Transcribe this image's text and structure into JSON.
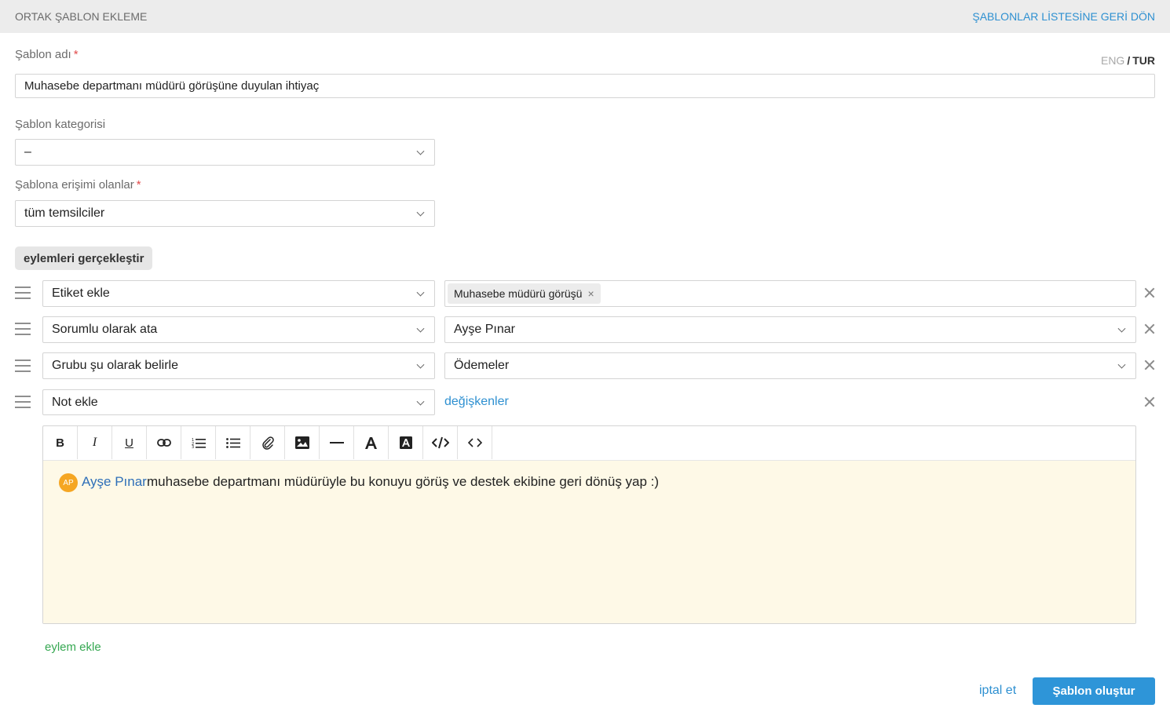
{
  "header": {
    "title": "ORTAK ŞABLON EKLEME",
    "back_link": "ŞABLONLAR LİSTESİNE GERİ DÖN"
  },
  "lang": {
    "eng": "ENG",
    "separator": "/",
    "tur": "TUR",
    "active": "TUR"
  },
  "form": {
    "name_label": "Şablon adı",
    "required_mark": "*",
    "name_value": "Muhasebe departmanı müdürü görüşüne duyulan ihtiyaç",
    "category_label": "Şablon kategorisi",
    "category_value": "–",
    "access_label": "Şablona erişimi olanlar",
    "access_value": "tüm temsilciler"
  },
  "actions": {
    "title": "eylemleri gerçekleştir",
    "rows": [
      {
        "action": "Etiket ekle",
        "tag": "Muhasebe müdürü görüşü",
        "tag_remove": "×"
      },
      {
        "action": "Sorumlu olarak ata",
        "value": "Ayşe Pınar"
      },
      {
        "action": "Grubu şu olarak belirle",
        "value": "Ödemeler"
      },
      {
        "action": "Not ekle",
        "variables_link": "değişkenler"
      }
    ],
    "add_action": "eylem ekle"
  },
  "editor": {
    "toolbar": [
      "bold",
      "italic",
      "underline",
      "link",
      "ordered-list",
      "bullet-list",
      "attachment",
      "image",
      "horizontal-rule",
      "font-color",
      "background-color",
      "code",
      "source"
    ],
    "toolbar_labels": {
      "bold": "B",
      "italic": "I",
      "underline": "U"
    },
    "mention_initials": "AP",
    "mention_name": "Ayşe Pınar",
    "text": " muhasebe departmanı müdürüyle bu konuyu görüş ve destek ekibine geri dönüş yap :)",
    "background_color": "#fef9e7"
  },
  "footer": {
    "cancel": "iptal et",
    "submit": "Şablon oluştur"
  },
  "colors": {
    "accent": "#2e90d1",
    "submit": "#2e95d8",
    "add_action": "#36a852",
    "required": "#e14b4b",
    "avatar": "#f5a623"
  }
}
